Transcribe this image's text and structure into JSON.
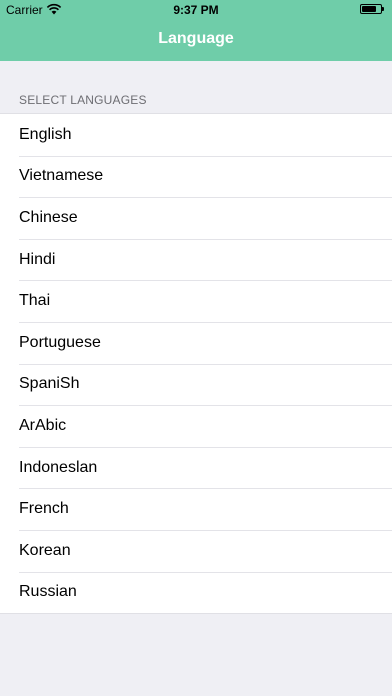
{
  "status_bar": {
    "carrier": "Carrier",
    "time": "9:37 PM"
  },
  "nav": {
    "title": "Language"
  },
  "section": {
    "header": "SELECT LANGUAGES"
  },
  "languages": [
    "English",
    "Vietnamese",
    "Chinese",
    "Hindi",
    "Thai",
    "Portuguese",
    "SpaniSh",
    "ArAbic",
    "Indoneslan",
    "French",
    "Korean",
    "Russian"
  ],
  "colors": {
    "nav_bar": "#6fcda9",
    "background": "#efeff4"
  }
}
